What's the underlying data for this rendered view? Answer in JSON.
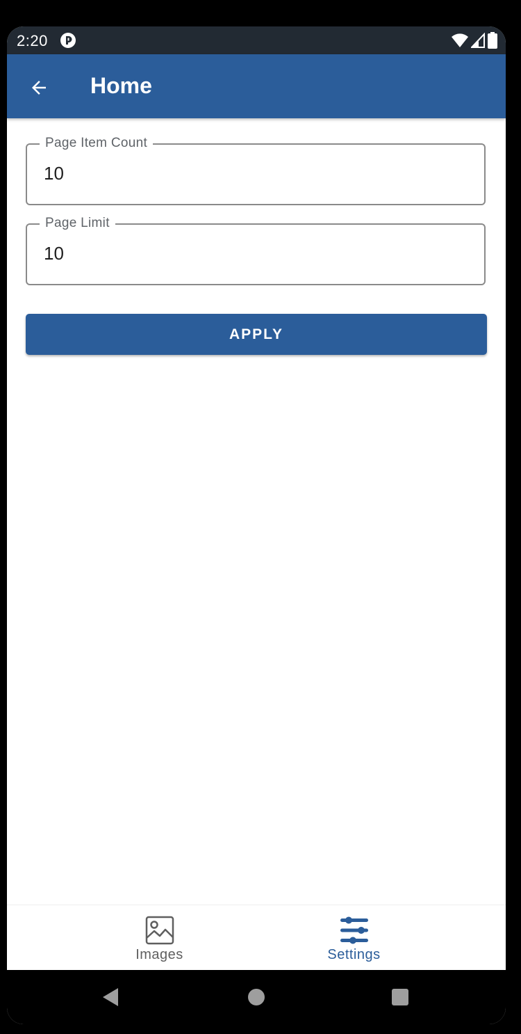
{
  "status_bar": {
    "time": "2:20"
  },
  "app_bar": {
    "title": "Home",
    "back_icon": "arrow-back-icon"
  },
  "form": {
    "page_item_count": {
      "label": "Page Item Count",
      "value": "10"
    },
    "page_limit": {
      "label": "Page Limit",
      "value": "10"
    },
    "apply_label": "APPLY"
  },
  "bottom_nav": {
    "items": [
      {
        "label": "Images",
        "icon": "image-icon",
        "active": false
      },
      {
        "label": "Settings",
        "icon": "sliders-icon",
        "active": true
      }
    ]
  },
  "colors": {
    "primary": "#2b5d9a",
    "status_bar": "#222a33",
    "inactive_nav": "#5f5f5f"
  }
}
